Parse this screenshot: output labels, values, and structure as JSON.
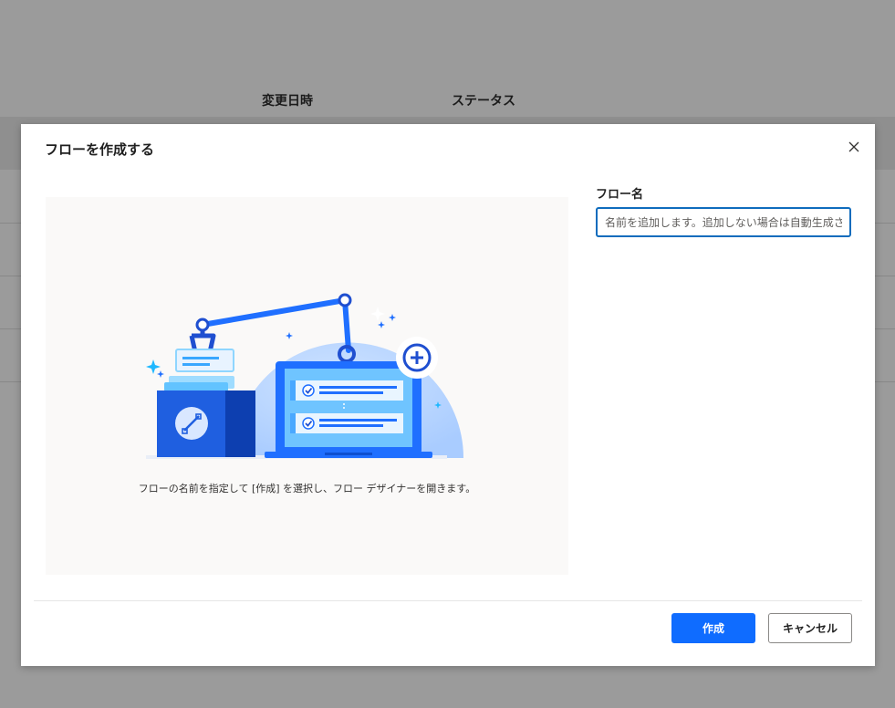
{
  "background": {
    "columns": [
      "変更日時",
      "ステータス"
    ]
  },
  "dialog": {
    "title": "フローを作成する",
    "close_icon": "close-icon",
    "illustration": {
      "caption": "フローの名前を指定して [作成] を選択し、フロー デザイナーを開きます。"
    },
    "form": {
      "name_label": "フロー名",
      "name_value": "",
      "name_placeholder": "名前を追加します。追加しない場合は自動生成されます"
    },
    "buttons": {
      "create": "作成",
      "cancel": "キャンセル"
    }
  },
  "colors": {
    "primary": "#0f6cff",
    "input_border": "#0f6cbd",
    "overlay": "#9b9b9b"
  }
}
